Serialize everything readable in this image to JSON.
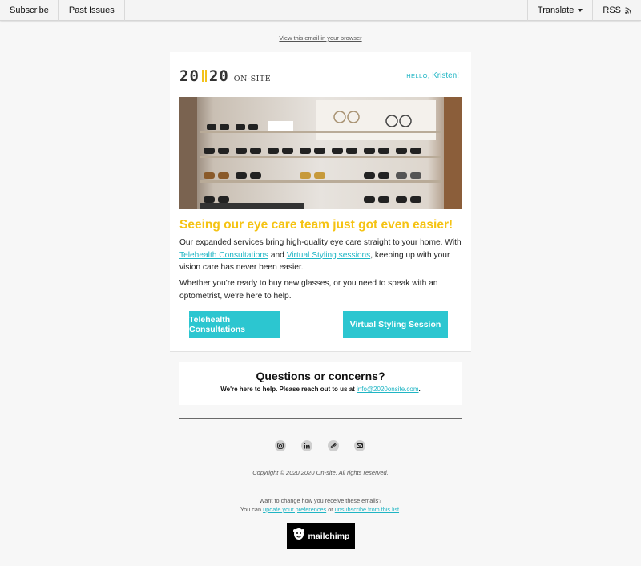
{
  "topbar": {
    "subscribe": "Subscribe",
    "past_issues": "Past Issues",
    "translate": "Translate",
    "rss": "RSS"
  },
  "view_in_browser": "View this email in your browser",
  "card": {
    "logo_number_left": "20",
    "logo_number_right": "20",
    "logo_sub": "ON-SITE",
    "hello_label": "HELLO,",
    "hello_name": "Kristen!",
    "headline": "Seeing our eye care team just got even easier!",
    "para1_start": "Our expanded services bring high-quality eye care straight to your home. With ",
    "para1_link1": "Telehealth Consultations",
    "para1_mid": " and ",
    "para1_link2": "Virtual Styling sessions",
    "para1_end": ", keeping up with your vision care has never been easier.",
    "para2": "Whether you're ready to buy new glasses, or you need to speak with an optometrist, we're here to help.",
    "button1": "Telehealth Consultations",
    "button2": "Virtual Styling Session"
  },
  "questions": {
    "title": "Questions or concerns?",
    "text_start": "We're here to help. Please reach out to us at ",
    "email": "info@2020onsite.com",
    "text_end": "."
  },
  "socials": [
    "instagram-icon",
    "linkedin-icon",
    "link-icon",
    "email-icon"
  ],
  "footer": {
    "copyright": "Copyright © 2020 2020 On-site, All rights reserved.",
    "prefs_line1": "Want to change how you receive these emails?",
    "prefs_you_can": "You can ",
    "prefs_update": "update your preferences",
    "prefs_or": " or ",
    "prefs_unsubscribe": "unsubscribe from this list",
    "prefs_end": "."
  },
  "mailchimp_label": "mailchimp",
  "colors": {
    "accent_teal": "#2cc6d0",
    "headline_yellow": "#f5c313",
    "background": "#f7f7f7"
  }
}
